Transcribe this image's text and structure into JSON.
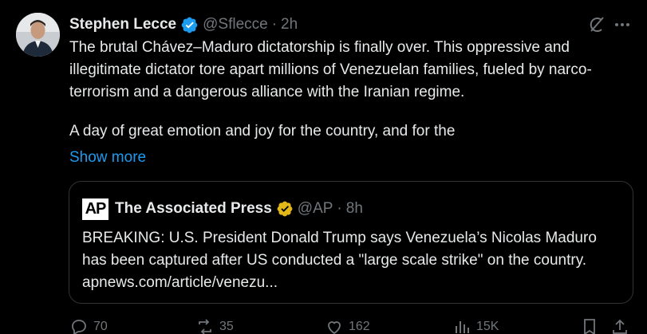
{
  "tweet": {
    "author": "Stephen Lecce",
    "handle": "@Sflecce",
    "separator": "·",
    "time": "2h",
    "paragraph1": "The brutal Chávez–Maduro dictatorship is finally over. This oppressive and illegitimate dictator tore apart millions of Venezuelan families, fueled by narco-terrorism and a dangerous alliance with the Iranian regime.",
    "paragraph2": "A day of great emotion and joy for the country, and for the",
    "show_more": "Show more"
  },
  "quote": {
    "logo_text": "AP",
    "author": "The Associated Press",
    "handle": "@AP",
    "separator": "·",
    "time": "8h",
    "text": "BREAKING: U.S. President Donald Trump says Venezuela’s Nicolas Maduro has been captured after US conducted a \"large scale strike\" on the country. apnews.com/article/venezu..."
  },
  "actions": {
    "replies": "70",
    "reposts": "35",
    "likes": "162",
    "views": "15K"
  },
  "colors": {
    "background": "#000000",
    "text": "#e7e9ea",
    "muted": "#71767b",
    "link": "#1d9bf0",
    "verified_blue": "#1d9bf0",
    "verified_gold": "#e2b719",
    "border": "#2f3336"
  }
}
